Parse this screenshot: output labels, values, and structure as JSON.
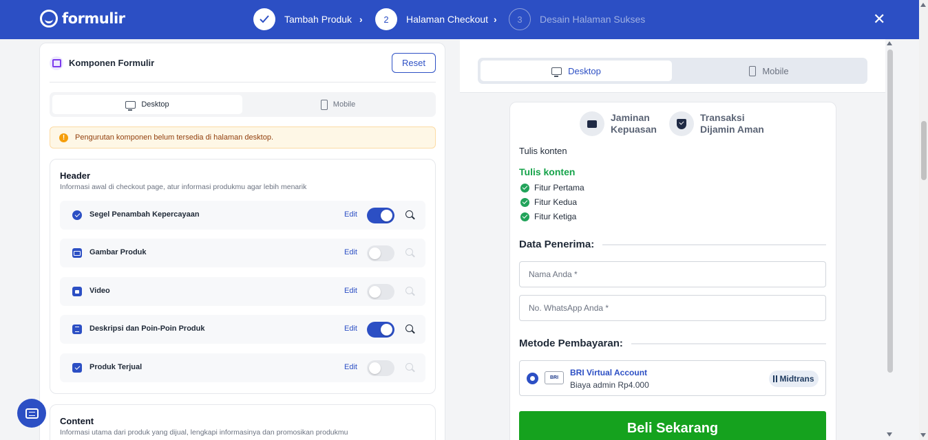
{
  "app": {
    "brand": "formulir"
  },
  "steps": [
    {
      "number": "✓",
      "label": "Tambah Produk",
      "state": "done"
    },
    {
      "number": "2",
      "label": "Halaman Checkout",
      "state": "active"
    },
    {
      "number": "3",
      "label": "Desain Halaman Sukses",
      "state": "pending"
    }
  ],
  "close_label": "✕",
  "left": {
    "title": "Komponen Formulir",
    "reset_label": "Reset",
    "view_tabs": {
      "desktop": "Desktop",
      "mobile": "Mobile"
    },
    "warning": "Pengurutan komponen belum tersedia di halaman desktop.",
    "header_section": {
      "title": "Header",
      "description": "Informasi awal di checkout page, atur informasi produkmu agar lebih menarik",
      "rows": [
        {
          "label": "Segel Penambah Kepercayaan",
          "edit": "Edit",
          "enabled": true,
          "icon": "badge-check-icon"
        },
        {
          "label": "Gambar Produk",
          "edit": "Edit",
          "enabled": false,
          "icon": "image-icon"
        },
        {
          "label": "Video",
          "edit": "Edit",
          "enabled": false,
          "icon": "video-icon"
        },
        {
          "label": "Deskripsi dan Poin-Poin Produk",
          "edit": "Edit",
          "enabled": true,
          "icon": "document-icon"
        },
        {
          "label": "Produk Terjual",
          "edit": "Edit",
          "enabled": false,
          "icon": "checkbox-icon"
        }
      ]
    },
    "content_section": {
      "title": "Content",
      "description": "Informasi utama dari produk yang dijual, lengkapi informasinya dan promosikan produkmu"
    }
  },
  "preview": {
    "view_tabs": {
      "desktop": "Desktop",
      "mobile": "Mobile"
    },
    "trust": [
      {
        "line1": "Jaminan",
        "line2": "Kepuasan",
        "icon": "thumbs-up-icon"
      },
      {
        "line1": "Transaksi",
        "line2": "Dijamin Aman",
        "icon": "shield-check-icon"
      }
    ],
    "content_text": "Tulis konten",
    "content_heading": "Tulis konten",
    "features": [
      "Fitur Pertama",
      "Fitur Kedua",
      "Fitur Ketiga"
    ],
    "recipient_heading": "Data Penerima:",
    "name_placeholder": "Nama Anda *",
    "whatsapp_placeholder": "No. WhatsApp Anda *",
    "payment_heading": "Metode Pembayaran:",
    "payment": {
      "logo": "BRI",
      "name": "BRI Virtual Account",
      "fee": "Biaya admin Rp4.000",
      "provider": "Midtrans"
    },
    "buy_label": "Beli Sekarang"
  },
  "colors": {
    "primary": "#2c4fc4",
    "success": "#15a21e",
    "warning_bg": "#fef7e6"
  }
}
